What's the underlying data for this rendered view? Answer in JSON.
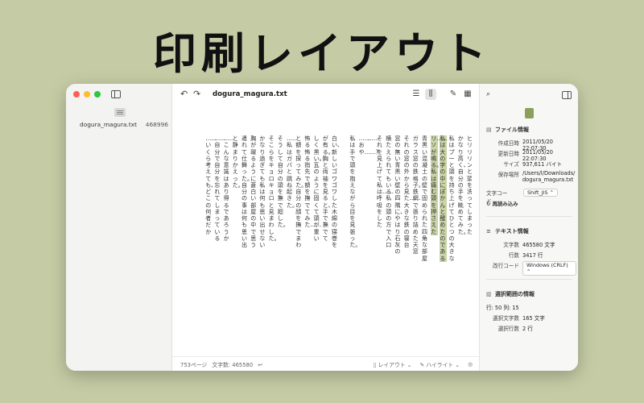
{
  "promo": {
    "title": "印刷レイアウト"
  },
  "sidebar": {
    "file_name": "dogura_magura.txt",
    "file_size": "468996"
  },
  "toolbar": {
    "title": "dogura_magura.txt",
    "back": "↶",
    "forward": "↷"
  },
  "page": {
    "columns": [
      {
        "text": "ヒリリリンと頭を洗ってしまった。",
        "hl": false
      },
      {
        "text": "かなり高く、自分の手を眺めてみた。",
        "hl": false
      },
      {
        "text": "私はプーと頭を持ち上げてひとつの大きな",
        "hl": false
      },
      {
        "text": "私は大の字の中にぽかんと醒めたのである",
        "hl": true
      },
      {
        "text": "リ……ソが鳴る。私は痛む頭を押さえた",
        "hl": true
      },
      {
        "text": "青黒い混凝土の壁で固められた四角な部屋",
        "hl": false
      },
      {
        "text": "ガラス窓の鉄格子。鉄網で張り詰めた天窓",
        "hl": false
      },
      {
        "text": "それの窓の外から見た……大きな鉄の寝台",
        "hl": false
      },
      {
        "text": "窓の無い青黒い壁の四隅に、やはり石灰の",
        "hl": false
      },
      {
        "text": "横たえられてもいる私の頭の方で入口",
        "hl": false
      },
      {
        "text": "それを見上げて私は……呼吸をした",
        "hl": false
      },
      {
        "text": "……",
        "hl": false
      },
      {
        "text": "……おや……？",
        "hl": false
      },
      {
        "text": "私は手で頭を抱えながら目を見張った。",
        "hl": false
      },
      {
        "text": "",
        "hl": false
      },
      {
        "text": "白い、新しいゴワゴワした木綿の寝巻を",
        "hl": false
      },
      {
        "text": "が有る。胸と両袖を見ると、手で撫でて",
        "hl": false
      },
      {
        "text": "しく黒い。瓦のように固くて頭が重い",
        "hl": false
      },
      {
        "text": "怖る怖る指先で額を撫でてみた……",
        "hl": false
      },
      {
        "text": "と額を探ってみた。自分の顔を撫でまわ",
        "hl": false
      },
      {
        "text": "……私はガバと跳ね起きた。",
        "hl": false
      },
      {
        "text": "そうして自分の頭を撫で廻した。",
        "hl": false
      },
      {
        "text": "そこらをキョロキョロと見まわした。",
        "hl": false
      },
      {
        "text": "かなり過ぎても私は何も思い出せない",
        "hl": false
      },
      {
        "text": "胸が躍るように蒼白い部屋の中で思う",
        "hl": false
      },
      {
        "text": "遣れて仕舞った。自分の事は何も思い出",
        "hl": false
      },
      {
        "text": "と静まりかえった。",
        "hl": false
      },
      {
        "text": "……こんな意識はあり得るであろうか",
        "hl": false
      },
      {
        "text": "……自分で自分を忘れてしまっている",
        "hl": false
      },
      {
        "text": "……いくら考えても、どこの何者だか",
        "hl": false
      }
    ]
  },
  "statusbar": {
    "pages": "753ページ",
    "chars": "文字数: 465580",
    "layout": "レイアウト",
    "highlight": "ハイライト"
  },
  "inspector": {
    "file_info_title": "ファイル情報",
    "created_label": "作成日時",
    "created_value": "2011/05/20 22:07:30",
    "modified_label": "更新日時",
    "modified_value": "2011/05/20 22:07:30",
    "size_label": "サイズ",
    "size_value": "937,611 バイト",
    "location_label": "保存場所",
    "location_value": "/Users/l/Downloads/dogura_magura.txt",
    "encoding_label": "文字コード",
    "encoding_value": "Shift_JIS",
    "reload_label": "再読み込み",
    "text_info_title": "テキスト情報",
    "char_count_label": "文字数",
    "char_count_value": "465580 文字",
    "line_count_label": "行数",
    "line_count_value": "3417 行",
    "newline_label": "改行コード",
    "newline_value": "Windows (CRLF)",
    "selection_title": "選択範囲の情報",
    "position_value": "行: 50 列: 15",
    "sel_chars_label": "選択文字数",
    "sel_chars_value": "165 文字",
    "sel_lines_label": "選択行数",
    "sel_lines_value": "2 行"
  }
}
